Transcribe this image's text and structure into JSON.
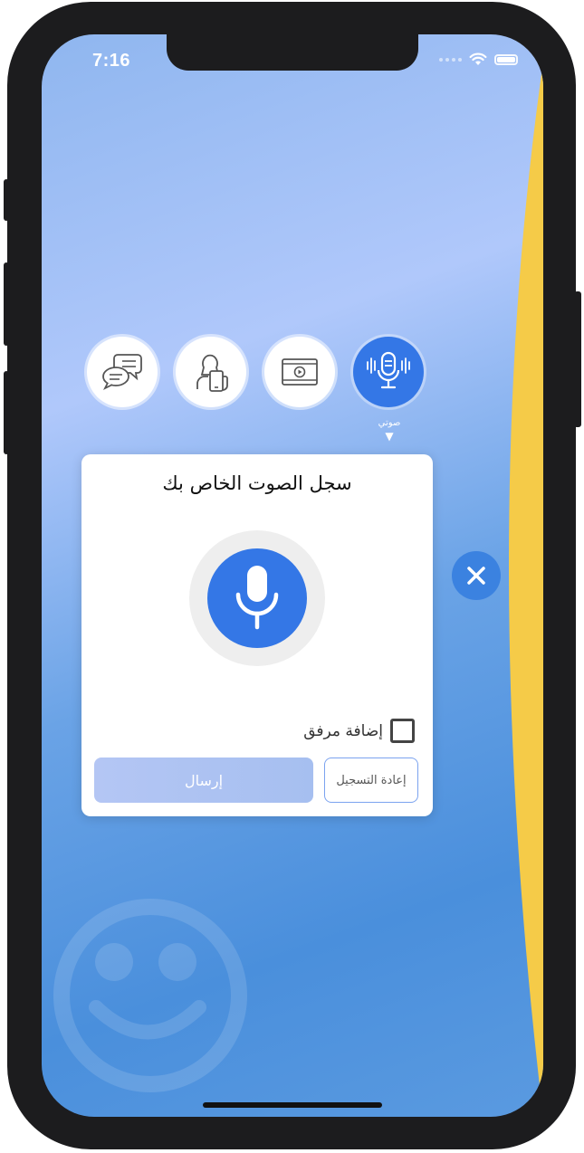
{
  "status_bar": {
    "time": "7:16"
  },
  "tabs": [
    {
      "icon": "chat-bubbles-icon",
      "active": false
    },
    {
      "icon": "selfie-phone-icon",
      "active": false
    },
    {
      "icon": "video-player-icon",
      "active": false
    },
    {
      "icon": "microphone-soundwave-icon",
      "active": true,
      "label": "صوتي"
    }
  ],
  "active_tab_caret": "▼",
  "card": {
    "title": "سجل الصوت الخاص بك",
    "attach_label": "إضافة مرفق",
    "attach_checked": false,
    "send_label": "إرسال",
    "rerecord_label": "إعادة التسجيل"
  },
  "colors": {
    "accent_blue": "#3477e6",
    "yellow_shape": "#f5cb48",
    "send_button": "#b4c6f4"
  }
}
